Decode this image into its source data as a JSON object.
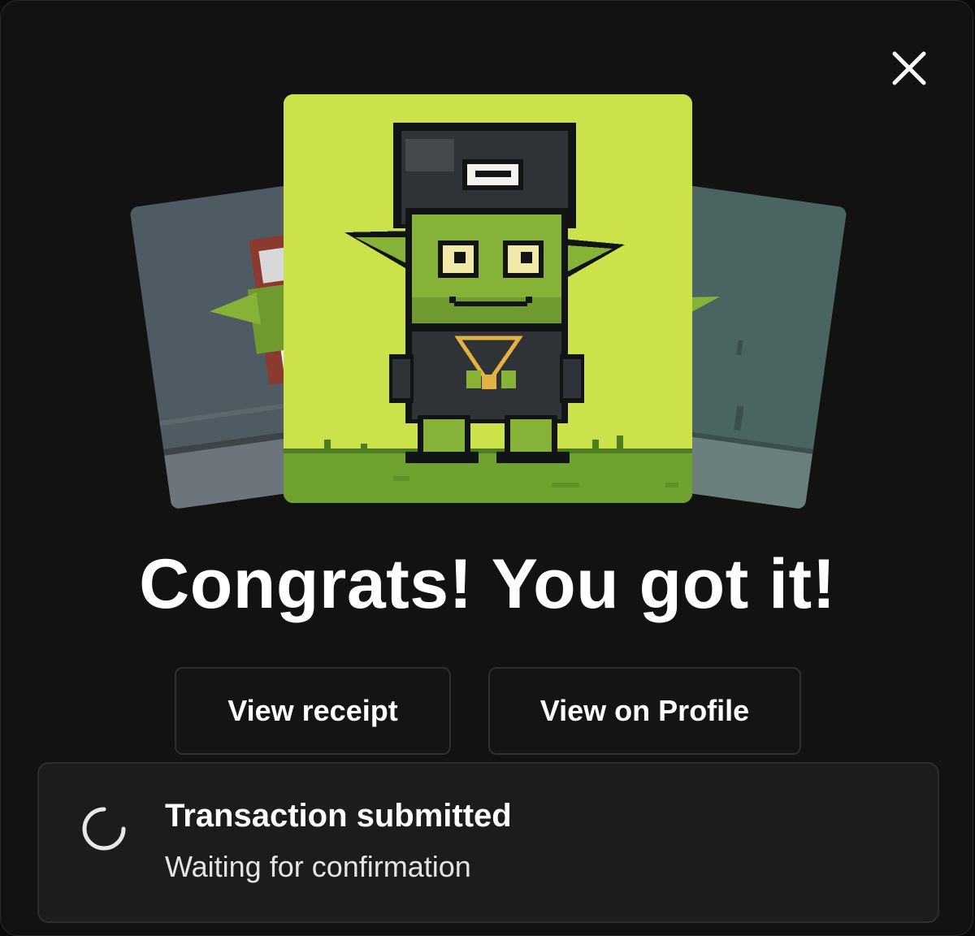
{
  "modal": {
    "close_icon": "close-icon",
    "headline": "Congrats! You got it!",
    "buttons": {
      "view_receipt": "View receipt",
      "view_on_profile": "View on Profile"
    },
    "toast": {
      "icon": "loading-spinner-icon",
      "title": "Transaction submitted",
      "subtitle": "Waiting for confirmation"
    },
    "nft_cards": {
      "center_background": "#cbe24b",
      "left_background": "#4f5b63",
      "right_background": "#4a6462"
    }
  }
}
